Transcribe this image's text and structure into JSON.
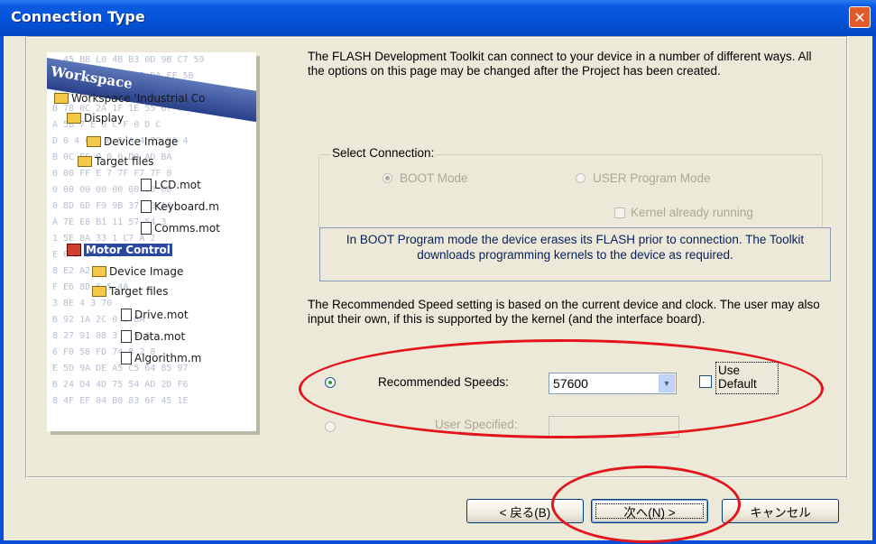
{
  "window": {
    "title": "Connection Type",
    "close_glyph": "✕"
  },
  "illustration": {
    "workspace_label": "Workspace",
    "hex_rows": [
      "  45 B8 L0 4B B3 0D 9B C7 59",
      "2F 4D 3D 2B C1 4B DA FF 5B",
      "7 2A 9A 21 0B 4D 5D 19 3F",
      "B 78 0C 2A 1F 1E 55 67 09 DD",
      "A 5B 7 E 0 C F 0 D C",
      "D 0 4 0 E 0 5 A 4 70 06 4",
      "B 0C EC 0 0 0 D0 AD BA",
      "0 00 FF E 7 7F F7 7F 0",
      "0 00 00 00 00 00 00 00",
      "0 8D 6D F9 9B 37 A0 1A",
      "A 7E E8 B1 11 57 54 3",
      "1 5E 8A 33 1 C7 A 2",
      "E 0 D 6 C 2 7",
      "8 E2 A2 4",
      "F E6 8D 6 5 4A",
      "3 8E 4 3 70",
      "B 92 1A 2C 0 0 8A",
      "8 27 91 08 3 2 9 A",
      "6 F0 58 FD 74 8 2 8",
      "E 5D 9A DE A5 C5 64 85 97",
      "B 24 D4 4D 75 54 AD 2D F6",
      "8 4F EF 04 B0 83 6F 45 1E"
    ],
    "tree": [
      {
        "label": "Workspace 'Industrial Co",
        "icon": "workspace-icon"
      },
      {
        "label": "Display",
        "icon": "display-icon"
      },
      {
        "label": "Device Image",
        "icon": "folder-icon"
      },
      {
        "label": "Target files",
        "icon": "folder-icon"
      },
      {
        "label": "LCD.mot",
        "icon": "file-icon"
      },
      {
        "label": "Keyboard.m",
        "icon": "file-icon"
      },
      {
        "label": "Comms.mot",
        "icon": "file-icon"
      },
      {
        "label": "Motor Control",
        "icon": "project-icon"
      },
      {
        "label": "Device Image",
        "icon": "folder-icon"
      },
      {
        "label": "Target files",
        "icon": "folder-icon"
      },
      {
        "label": "Drive.mot",
        "icon": "file-icon"
      },
      {
        "label": "Data.mot",
        "icon": "file-icon"
      },
      {
        "label": "Algorithm.m",
        "icon": "file-icon"
      }
    ]
  },
  "intro_text": "The FLASH Development Toolkit can connect to your device in a number of different ways. All the options on this page may be changed after the Project has been created.",
  "select_connection": {
    "legend": "Select Connection:",
    "boot_mode": "BOOT Mode",
    "user_program_mode": "USER Program Mode",
    "boot_selected": true,
    "kernel_running": "Kernel already running"
  },
  "info_text": "In BOOT Program mode the device erases its FLASH prior to connection. The Toolkit downloads programming kernels to the device as required.",
  "speed_text": "The Recommended Speed setting is based on the current device and clock. The user may also input their own, if this is supported by the kernel (and the interface board).",
  "speed": {
    "recommended_label": "Recommended Speeds:",
    "recommended_value": "57600",
    "recommended_selected": true,
    "use_default_line1": "Use",
    "use_default_line2": "Default",
    "user_specified_label": "User Specified:",
    "user_specified_value": ""
  },
  "buttons": {
    "back": "< 戻る(B)",
    "next": "次へ(N) >",
    "cancel": "キャンセル"
  },
  "colors": {
    "annotation": "#e3141b",
    "titlebar": "#0552d8",
    "dialog_bg": "#ece9d8"
  }
}
